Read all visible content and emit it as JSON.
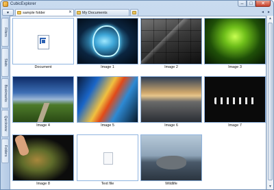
{
  "window": {
    "title": "CubicExplorer"
  },
  "window_controls": {
    "minimize": "–",
    "maximize": "□",
    "close": "✕"
  },
  "tabs": [
    {
      "label": "sample folder",
      "active": true
    },
    {
      "label": "My Documents",
      "active": false
    }
  ],
  "tab_close_glyph": "✕",
  "nav_glyphs": {
    "left": "◂",
    "right": "▸",
    "menu": "▾"
  },
  "side_panels": [
    "Filters",
    "Bookmarks",
    "Quickview",
    "Folders",
    "Stats"
  ],
  "items": [
    {
      "label": "Document",
      "kind": "word-document-icon"
    },
    {
      "label": "Image 1",
      "kind": "image"
    },
    {
      "label": "Image 2",
      "kind": "image"
    },
    {
      "label": "Image 3",
      "kind": "image"
    },
    {
      "label": "Image 4",
      "kind": "image"
    },
    {
      "label": "Image 5",
      "kind": "image"
    },
    {
      "label": "Image 6",
      "kind": "image"
    },
    {
      "label": "Image 7",
      "kind": "image"
    },
    {
      "label": "Image 8",
      "kind": "image"
    },
    {
      "label": "Text file",
      "kind": "text-file-icon"
    },
    {
      "label": "Wildlife",
      "kind": "video"
    }
  ],
  "colors": {
    "accent": "#8fb4e0",
    "chrome": "#c2d5ec"
  }
}
